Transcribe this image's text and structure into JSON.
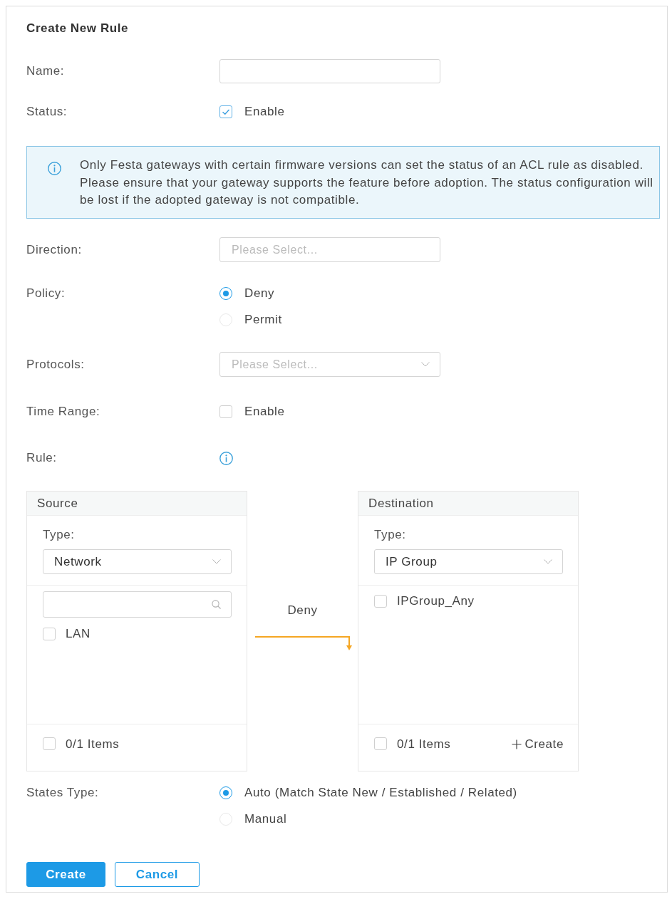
{
  "dialog": {
    "title": "Create New Rule"
  },
  "form": [
    {
      "kind": "text",
      "label": "Name:"
    },
    {
      "kind": "checkbox",
      "label": "Status:",
      "option": "Enable",
      "checked": true
    },
    {
      "kind": "notice",
      "text": "Only Festa gateways with certain firmware versions can set the status of an ACL rule as disabled. Please ensure that your gateway supports the feature before adoption. The status configuration will be lost if the adopted gateway is not compatible."
    },
    {
      "kind": "select",
      "label": "Direction:",
      "placeholder": "Please Select...",
      "caret": false
    },
    {
      "kind": "radio",
      "label": "Policy:",
      "options": [
        {
          "label": "Deny",
          "selected": true
        },
        {
          "label": "Permit",
          "selected": false
        }
      ]
    },
    {
      "kind": "select",
      "label": "Protocols:",
      "placeholder": "Please Select...",
      "caret": true
    },
    {
      "kind": "checkbox",
      "label": "Time Range:",
      "option": "Enable",
      "checked": false
    },
    {
      "kind": "info",
      "label": "Rule:"
    },
    {
      "kind": "transfer",
      "source": {
        "title": "Source",
        "type_label": "Type:",
        "type_value": "Network",
        "search": true,
        "items": [
          {
            "label": "LAN",
            "checked": false
          }
        ],
        "footer": {
          "count": "0/1 Items",
          "checked": false
        }
      },
      "action": "Deny",
      "destination": {
        "title": "Destination",
        "type_label": "Type:",
        "type_value": "IP Group",
        "search": false,
        "items": [
          {
            "label": "IPGroup_Any",
            "checked": false
          }
        ],
        "footer": {
          "count": "0/1 Items",
          "checked": false,
          "create": "Create"
        }
      }
    },
    {
      "kind": "radio",
      "label": "States Type:",
      "options": [
        {
          "label": "Auto (Match State New / Established / Related)",
          "selected": true
        },
        {
          "label": "Manual",
          "selected": false
        }
      ]
    }
  ],
  "buttons": [
    {
      "label": "Create",
      "kind": "primary"
    },
    {
      "label": "Cancel",
      "kind": "secondary"
    }
  ]
}
